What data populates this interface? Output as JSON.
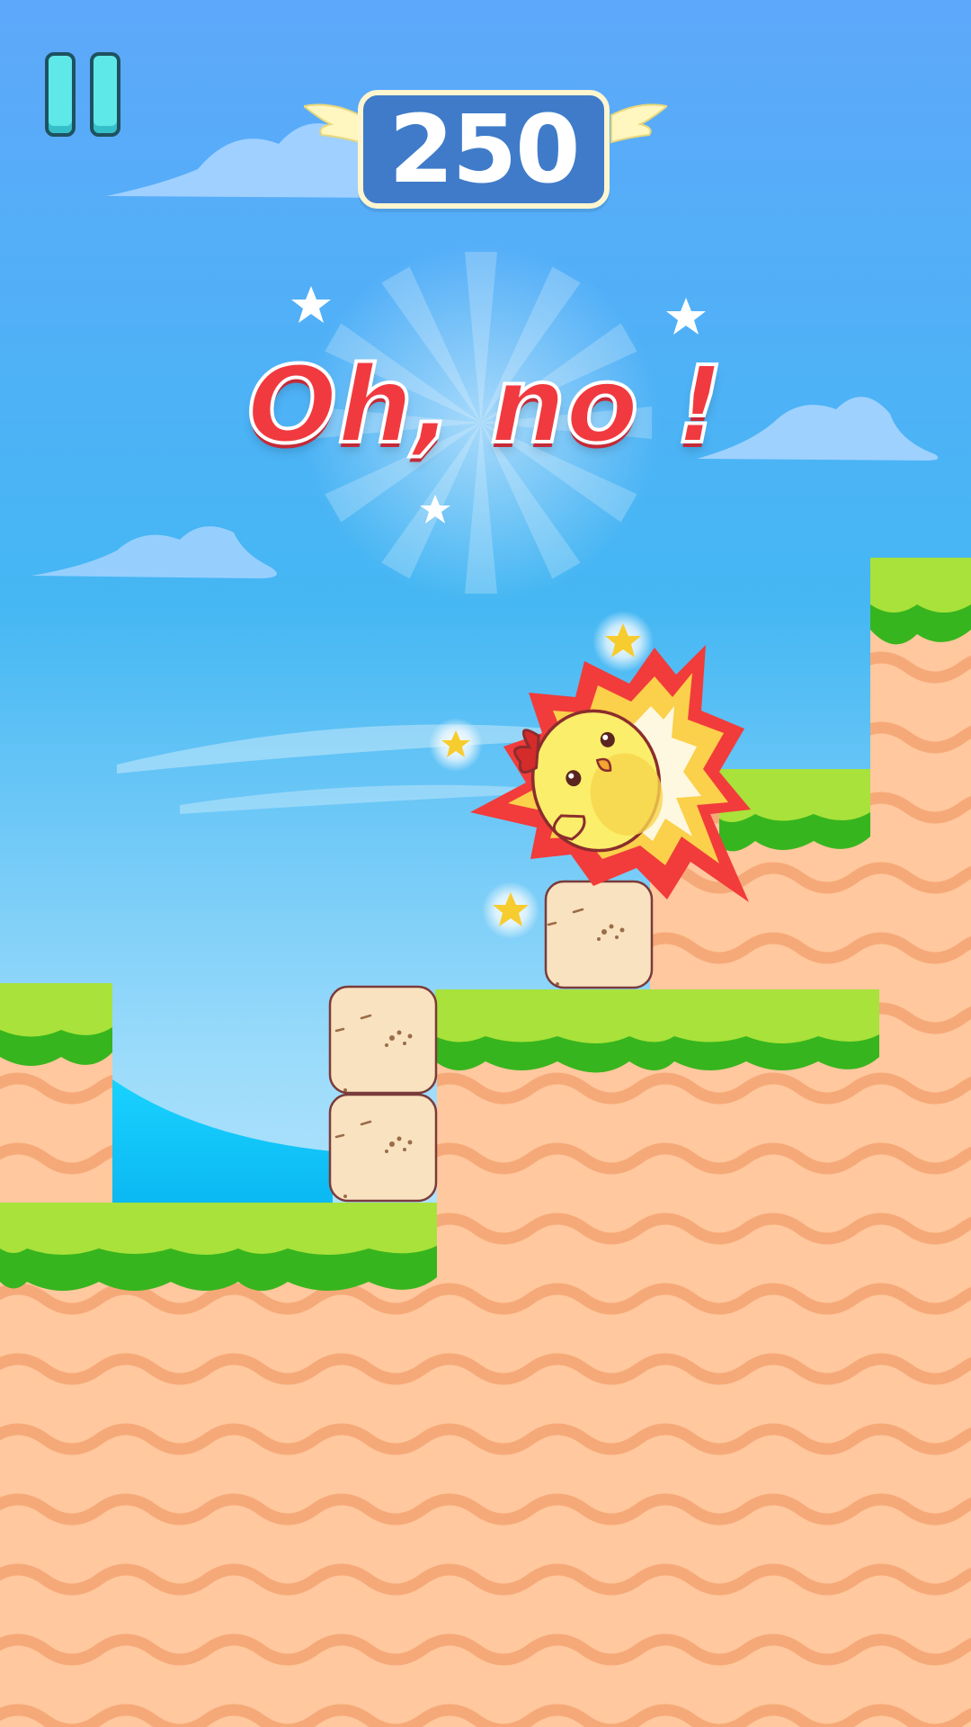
{
  "hud": {
    "score": "250",
    "pause_icon": "pause-icon"
  },
  "banner": {
    "text": "Oh, no !"
  },
  "colors": {
    "sky_top": "#5ea8fb",
    "sky_bottom": "#e9f8ff",
    "grass_light": "#a8e23a",
    "grass_dark": "#37b51e",
    "dirt": "#ffc89e",
    "dirt_wave": "#f6a978",
    "block": "#f9dfb8",
    "score_box": "#3f7bc9",
    "banner_red": "#f03a3f",
    "chick_yellow": "#fbee6a"
  }
}
